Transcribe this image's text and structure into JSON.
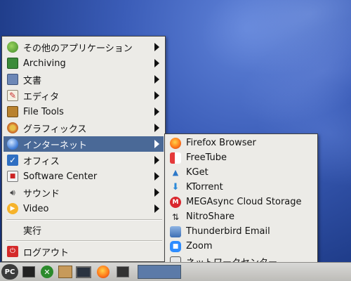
{
  "colors": {
    "menu_bg": "#ecebe7",
    "highlight": "#4a6997",
    "taskbar": "#c9c8c4"
  },
  "main_menu": {
    "items": [
      {
        "label": "その他のアプリケーション",
        "icon": "other-apps-icon"
      },
      {
        "label": "Archiving",
        "icon": "archive-icon"
      },
      {
        "label": "文書",
        "icon": "document-icon"
      },
      {
        "label": "エディタ",
        "icon": "editor-icon"
      },
      {
        "label": "File Tools",
        "icon": "file-tools-icon"
      },
      {
        "label": "グラフィックス",
        "icon": "graphics-icon"
      },
      {
        "label": "インターネット",
        "icon": "internet-icon",
        "active": true
      },
      {
        "label": "オフィス",
        "icon": "office-icon"
      },
      {
        "label": "Software Center",
        "icon": "software-center-icon"
      },
      {
        "label": "サウンド",
        "icon": "sound-icon"
      },
      {
        "label": "Video",
        "icon": "video-icon"
      }
    ],
    "run_label": "実行",
    "logout_label": "ログアウト"
  },
  "internet_submenu": {
    "items": [
      {
        "label": "Firefox Browser",
        "icon": "firefox-icon"
      },
      {
        "label": "FreeTube",
        "icon": "freetube-icon"
      },
      {
        "label": "KGet",
        "icon": "kget-icon"
      },
      {
        "label": "KTorrent",
        "icon": "ktorrent-icon"
      },
      {
        "label": "MEGAsync Cloud Storage",
        "icon": "mega-icon"
      },
      {
        "label": "NitroShare",
        "icon": "nitroshare-icon"
      },
      {
        "label": "Thunderbird Email",
        "icon": "thunderbird-icon"
      },
      {
        "label": "Zoom",
        "icon": "zoom-icon"
      },
      {
        "label": "ネットワークセンター",
        "icon": "network-center-icon"
      }
    ]
  },
  "taskbar": {
    "start_label": "PC",
    "launchers": [
      "terminal-icon",
      "xbox-icon",
      "package-icon",
      "monitor-icon",
      "firefox-icon",
      "window-icon"
    ]
  }
}
